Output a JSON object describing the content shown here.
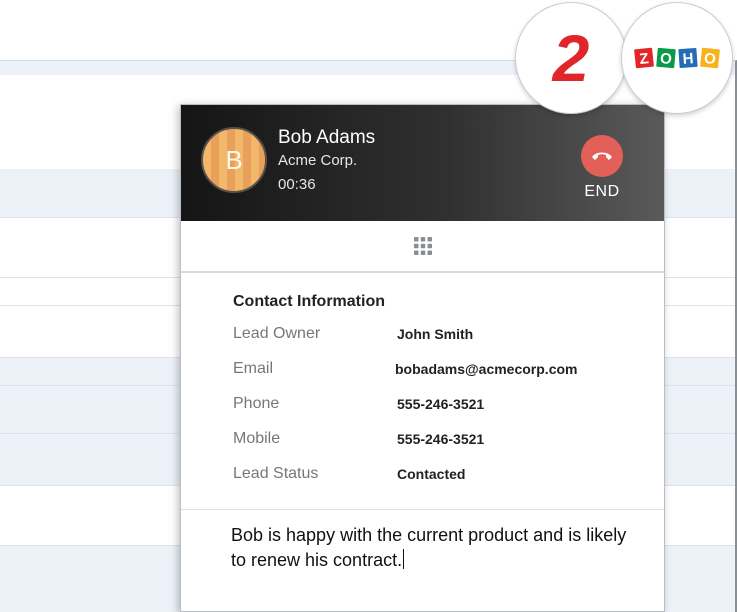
{
  "step_badge": {
    "number": "2"
  },
  "brand": {
    "logo_letters": [
      "Z",
      "O",
      "H",
      "O"
    ],
    "logo_colors": [
      "#e42527",
      "#089949",
      "#226db4",
      "#f9b21d"
    ]
  },
  "call": {
    "avatar_initial": "B",
    "caller_name": "Bob Adams",
    "company": "Acme Corp.",
    "timer": "00:36",
    "end_label": "END",
    "end_color": "#e26058"
  },
  "contact": {
    "title": "Contact Information",
    "fields": [
      {
        "label": "Lead Owner",
        "value": "John Smith"
      },
      {
        "label": "Email",
        "value": "bobadams@acmecorp.com"
      },
      {
        "label": "Phone",
        "value": "555-246-3521"
      },
      {
        "label": "Mobile",
        "value": "555-246-3521"
      },
      {
        "label": "Lead Status",
        "value": "Contacted"
      }
    ]
  },
  "notes": {
    "text": "Bob is happy with the current product and is likely to renew his contract."
  }
}
